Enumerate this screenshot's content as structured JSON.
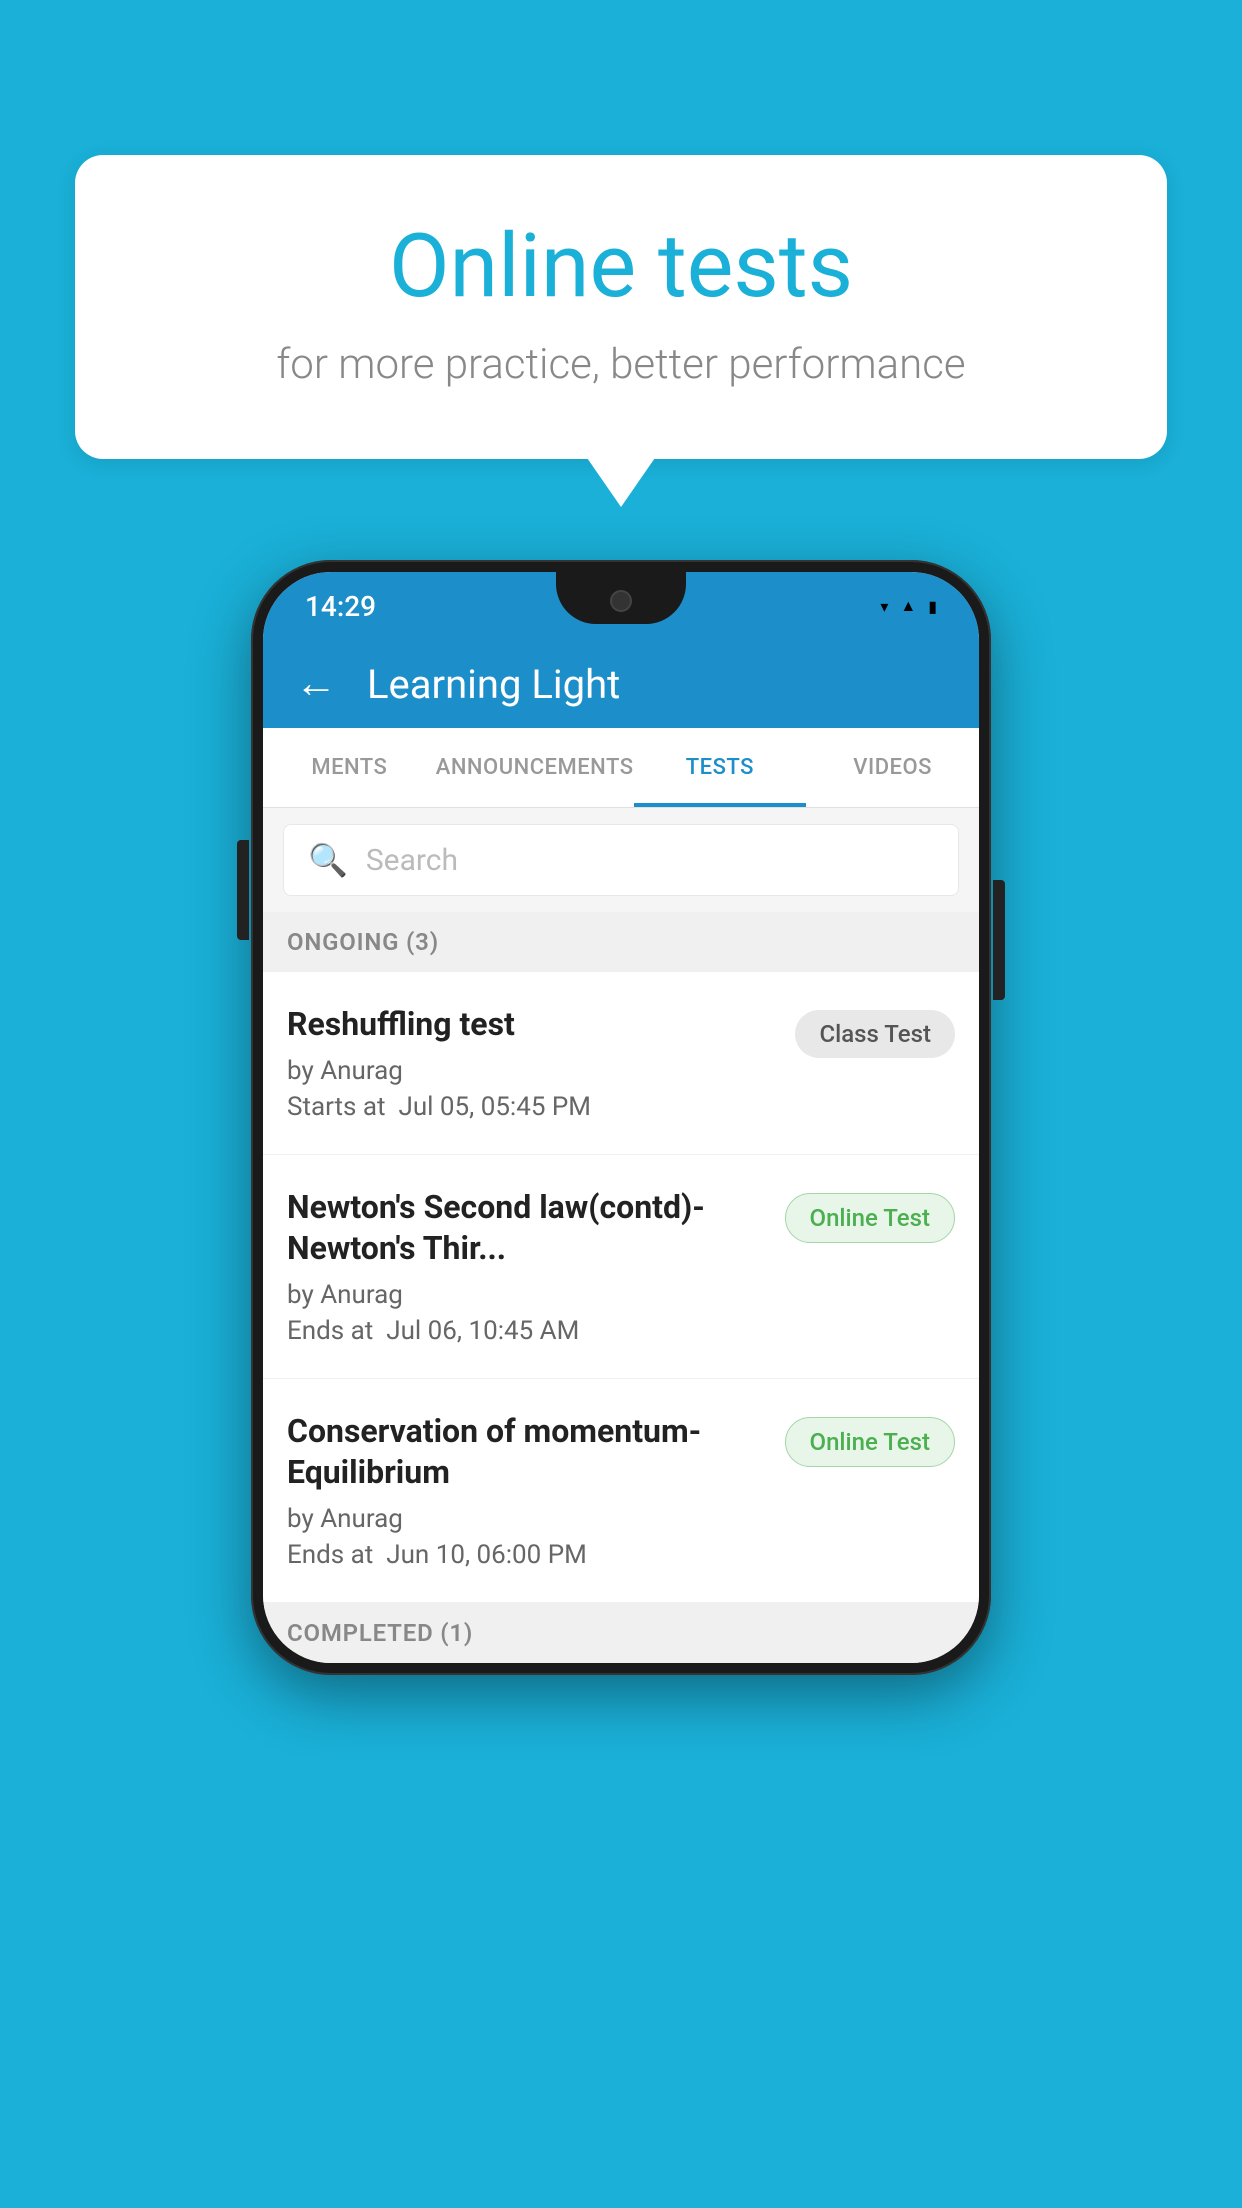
{
  "background_color": "#1ab0d8",
  "speech_bubble": {
    "title": "Online tests",
    "subtitle": "for more practice, better performance"
  },
  "phone": {
    "status_bar": {
      "time": "14:29",
      "icons": [
        "wifi",
        "signal",
        "battery"
      ]
    },
    "app_header": {
      "back_label": "←",
      "title": "Learning Light"
    },
    "tabs": [
      {
        "label": "MENTS",
        "active": false
      },
      {
        "label": "ANNOUNCEMENTS",
        "active": false
      },
      {
        "label": "TESTS",
        "active": true
      },
      {
        "label": "VIDEOS",
        "active": false
      }
    ],
    "search": {
      "placeholder": "Search"
    },
    "ongoing_section": {
      "label": "ONGOING (3)"
    },
    "tests": [
      {
        "name": "Reshuffling test",
        "author": "by Anurag",
        "time_label": "Starts at",
        "time": "Jul 05, 05:45 PM",
        "badge": "Class Test",
        "badge_type": "class"
      },
      {
        "name": "Newton's Second law(contd)-Newton's Thir...",
        "author": "by Anurag",
        "time_label": "Ends at",
        "time": "Jul 06, 10:45 AM",
        "badge": "Online Test",
        "badge_type": "online"
      },
      {
        "name": "Conservation of momentum-Equilibrium",
        "author": "by Anurag",
        "time_label": "Ends at",
        "time": "Jun 10, 06:00 PM",
        "badge": "Online Test",
        "badge_type": "online"
      }
    ],
    "completed_section": {
      "label": "COMPLETED (1)"
    }
  }
}
